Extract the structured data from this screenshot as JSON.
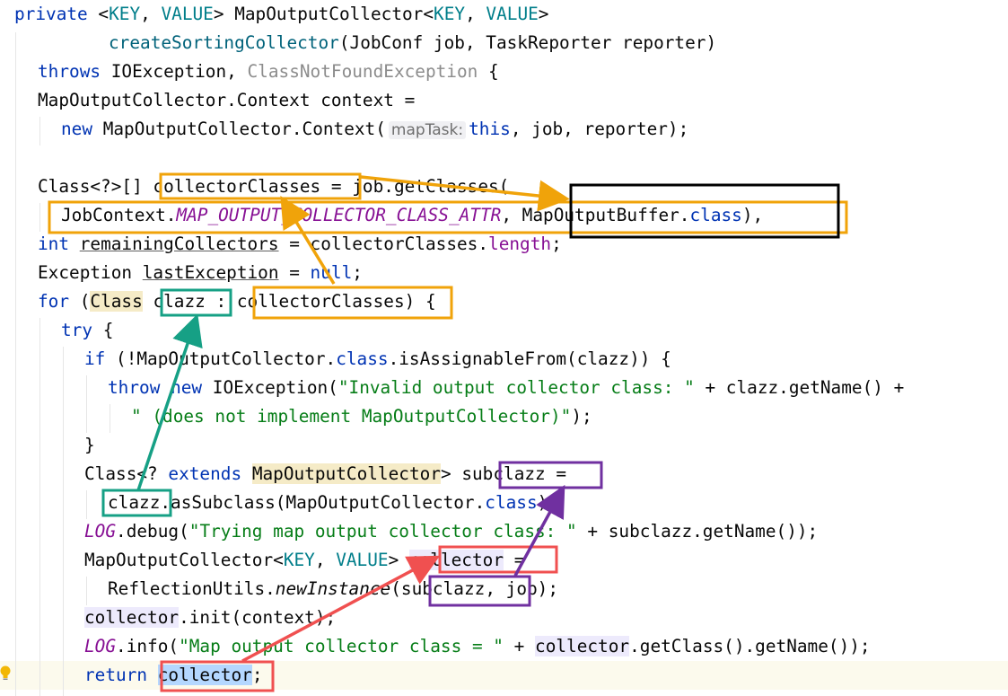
{
  "code": {
    "l1": {
      "a": "private ",
      "b": "<",
      "c": "KEY",
      "d": ", ",
      "e": "VALUE",
      "f": "> MapOutputCollector<",
      "g": "KEY",
      "h": ", ",
      "i": "VALUE",
      "j": ">"
    },
    "l2": {
      "a": "createSortingCollector",
      "b": "(JobConf job, TaskReporter reporter)"
    },
    "l3": {
      "a": "throws",
      "b": " IOException, ",
      "c": "ClassNotFoundException",
      "d": " {"
    },
    "l4": {
      "a": "MapOutputCollector.Context context ="
    },
    "l5": {
      "a": "new",
      "b": " MapOutputCollector.Context(",
      "hint": "mapTask:",
      "c": "this",
      "d": ", job, reporter);"
    },
    "l7": {
      "a": "Class<?>[] ",
      "b": "collectorClasses",
      "c": " = job.getClasses("
    },
    "l8": {
      "a": "JobContext.",
      "b": "MAP_OUTPUT_COLLECTOR_CLASS_ATTR",
      "c": ", MapOutputBuffer.",
      "d": "class",
      "e": "),"
    },
    "l9": {
      "a": "int",
      "b": " ",
      "c": "remainingCollectors",
      "d": " = collectorClasses.",
      "e": "length",
      "f": ";"
    },
    "l10": {
      "a": "Exception ",
      "b": "lastException",
      "c": " = ",
      "d": "null",
      "e": ";"
    },
    "l11": {
      "a": "for",
      "b": " (",
      "c": "Class",
      "d": " ",
      "e": "clazz",
      "f": " : ",
      "g": "collectorClasses",
      "h": ") {"
    },
    "l12": {
      "a": "try",
      "b": " {"
    },
    "l13": {
      "a": "if",
      "b": " (!MapOutputCollector.",
      "c": "class",
      "d": ".isAssignableFrom(clazz)) {"
    },
    "l14": {
      "a": "throw",
      "b": " ",
      "c": "new",
      "d": " IOException(",
      "e": "\"Invalid output collector class: \"",
      "f": " + clazz.getName() +"
    },
    "l15": {
      "a": "\" (does not implement MapOutputCollector)\"",
      "b": ");"
    },
    "l16": {
      "a": "}"
    },
    "l17": {
      "a": "Class<? ",
      "b": "extends",
      "c": " ",
      "d": "MapOutputCollector",
      "e": "> ",
      "f": "subclazz",
      "g": " ="
    },
    "l18": {
      "a": "clazz",
      "b": ".asSubclass(MapOutputCollector.",
      "c": "class",
      "d": ");"
    },
    "l19": {
      "a": "LOG",
      "b": ".debug(",
      "c": "\"Trying map output collector class: \"",
      "d": " + subclazz.getName());"
    },
    "l20": {
      "a": "MapOutputCollector<",
      "b": "KEY",
      "c": ", ",
      "d": "VALUE",
      "e": "> ",
      "f": "collector",
      "g": " ="
    },
    "l21": {
      "a": "ReflectionUtils.",
      "b": "newInstance",
      "c": "(",
      "d": "subclazz",
      "e": ", job);"
    },
    "l22": {
      "a": "collector",
      "b": ".init(context);"
    },
    "l23": {
      "a": "LOG",
      "b": ".info(",
      "c": "\"Map output collector class = \"",
      "d": " + ",
      "e": "collector",
      "f": ".getClass().getName());"
    },
    "l24": {
      "a": "return",
      "b": " ",
      "c": "collector",
      "d": ";"
    }
  },
  "annotations": {
    "orange": "#f0a30a",
    "black": "#000000",
    "teal": "#16a085",
    "purple": "#7030a0",
    "red": "#f05050"
  }
}
